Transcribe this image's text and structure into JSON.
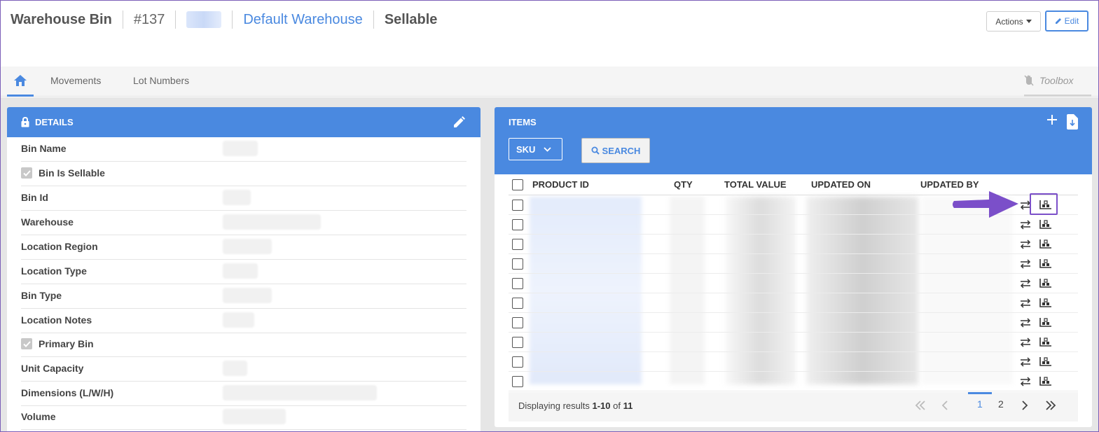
{
  "header": {
    "title": "Warehouse Bin",
    "number": "#137",
    "warehouse_link": "Default Warehouse",
    "sellable": "Sellable",
    "actions_label": "Actions",
    "edit_label": "Edit"
  },
  "tabs": {
    "items": [
      {
        "label": "Movements"
      },
      {
        "label": "Lot Numbers"
      }
    ],
    "toolbox_label": "Toolbox"
  },
  "details": {
    "title": "DETAILS",
    "fields": [
      {
        "label": "Bin Name"
      },
      {
        "label": "Bin Is Sellable",
        "checkbox": true
      },
      {
        "label": "Bin Id"
      },
      {
        "label": "Warehouse"
      },
      {
        "label": "Location Region"
      },
      {
        "label": "Location Type"
      },
      {
        "label": "Bin Type"
      },
      {
        "label": "Location Notes"
      },
      {
        "label": "Primary Bin",
        "checkbox": true
      },
      {
        "label": "Unit Capacity"
      },
      {
        "label": "Dimensions (L/W/H)"
      },
      {
        "label": "Volume"
      }
    ]
  },
  "items": {
    "title": "ITEMS",
    "filter_select": "SKU",
    "search_label": "SEARCH",
    "columns": [
      "PRODUCT ID",
      "QTY",
      "TOTAL VALUE",
      "UPDATED ON",
      "UPDATED BY"
    ],
    "row_count": 10,
    "pagination": {
      "prefix": "Displaying results ",
      "range": "1-10",
      "of_text": " of ",
      "total": "11",
      "pages": [
        "1",
        "2"
      ],
      "current_page": "1"
    }
  },
  "colors": {
    "accent": "#4a89e0",
    "highlight": "#7b4fc9"
  }
}
